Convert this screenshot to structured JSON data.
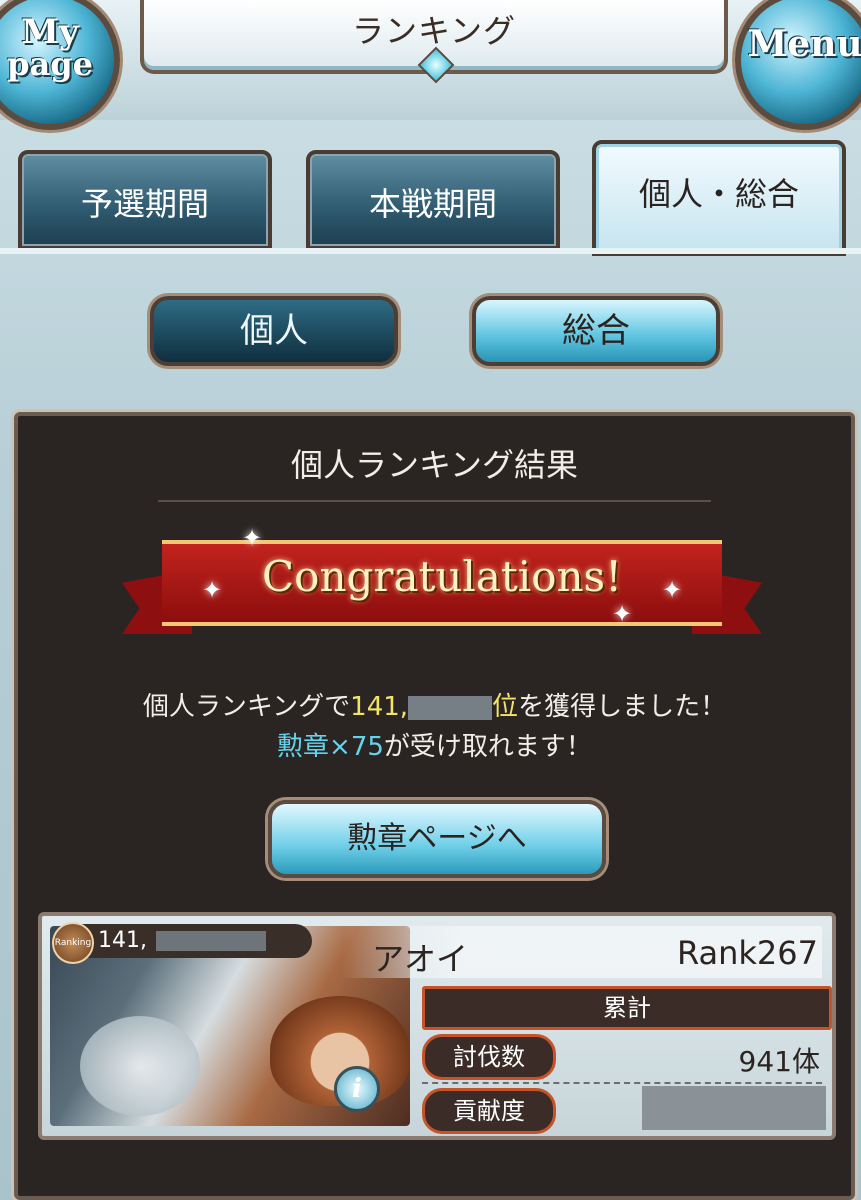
{
  "header": {
    "title": "ランキング",
    "mypage": {
      "line1": "My",
      "line2": "page"
    },
    "menu_label": "Menu"
  },
  "tabs": [
    {
      "label": "予選期間",
      "active": false
    },
    {
      "label": "本戦期間",
      "active": false
    },
    {
      "label": "個人・総合",
      "active": true
    }
  ],
  "segments": {
    "individual": "個人",
    "overall": "総合"
  },
  "panel": {
    "title": "個人ランキング結果",
    "banner": "Congratulations!",
    "message": {
      "prefix": "個人ランキングで",
      "rank_visible": "141,",
      "rank_suffix": "位",
      "suffix": "を獲得しました！"
    },
    "reward": {
      "item": "勲章×75",
      "suffix": "が受け取れます！"
    },
    "button_label": "勲章ページへ"
  },
  "player_card": {
    "ranking_badge": "Ranking",
    "rank_visible": "141,",
    "name": "アオイ",
    "level": "Rank267",
    "total_header": "累計",
    "kills_label": "討伐数",
    "kills_value": "941体",
    "contribution_label": "貢献度",
    "info_icon": "i"
  }
}
